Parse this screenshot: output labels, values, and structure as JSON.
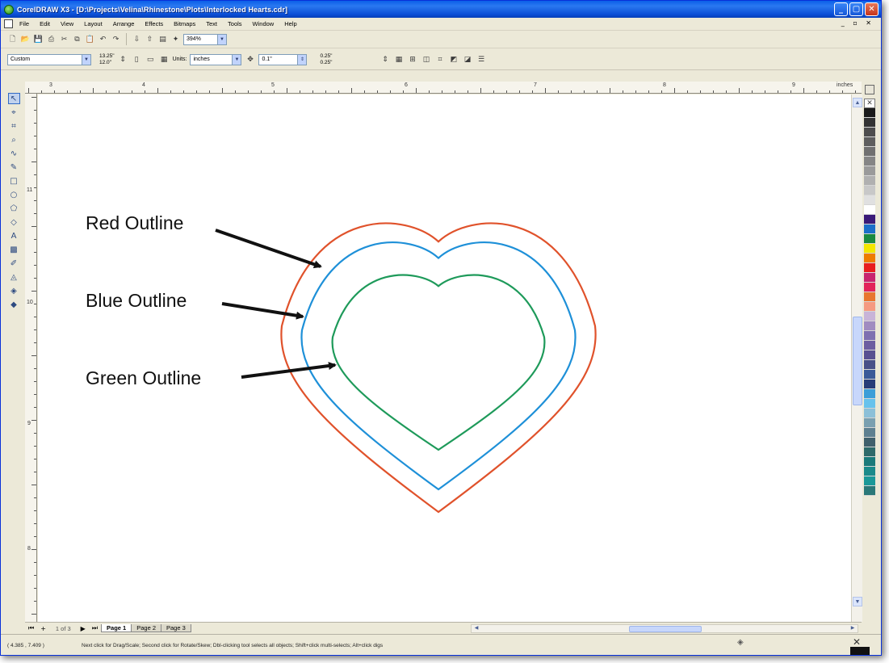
{
  "window": {
    "title": "CorelDRAW X3 - [D:\\Projects\\Velina\\Rhinestone\\Plots\\Interlocked Hearts.cdr]",
    "controls": {
      "minimize": "_",
      "maximize": "▢",
      "close": "✕"
    }
  },
  "menubar": {
    "items": [
      "File",
      "Edit",
      "View",
      "Layout",
      "Arrange",
      "Effects",
      "Bitmaps",
      "Text",
      "Tools",
      "Window",
      "Help"
    ],
    "mdi_controls": "_ ▫ ✕"
  },
  "toolbar": {
    "zoom_value": "394%"
  },
  "property_bar": {
    "paper_type": "Custom",
    "page_width": "13.25\"",
    "page_height": "12.0\"",
    "units_label": "Units:",
    "units_value": "inches",
    "nudge_value": "0.1\"",
    "duplicate_x": "0.25\"",
    "duplicate_y": "0.25\""
  },
  "ruler": {
    "h_labels": [
      "3",
      "4",
      "5",
      "6",
      "7",
      "8",
      "9"
    ],
    "unit": "inches",
    "v_labels": [
      "11",
      "10",
      "9",
      "8"
    ]
  },
  "canvas": {
    "shapes": [
      {
        "name": "Red Outline",
        "color": "#e0522b"
      },
      {
        "name": "Blue Outline",
        "color": "#1e90d8"
      },
      {
        "name": "Green Outline",
        "color": "#1e9a5a"
      }
    ],
    "callouts": {
      "red": "Red Outline",
      "blue": "Blue Outline",
      "green": "Green Outline"
    }
  },
  "palette": {
    "colors": [
      "#1a1a1a",
      "#333333",
      "#4d4d4d",
      "#5e5e5e",
      "#707070",
      "#858585",
      "#9a9a9a",
      "#b0b0b0",
      "#c8c8c8",
      "#e0e0e0",
      "#ffffff",
      "#3a1a78",
      "#1c6fc8",
      "#1a8a40",
      "#f2e600",
      "#ee7c00",
      "#e81e1e",
      "#c8246e",
      "#e2245a",
      "#e8762e",
      "#f59a80",
      "#c8b4d8",
      "#a08cc0",
      "#7e70b0",
      "#6c5ea0",
      "#585090",
      "#485088",
      "#3a5a98",
      "#283c78",
      "#3c9ed8",
      "#68c2ec",
      "#8cc0d8",
      "#7aa0b0",
      "#5e8090",
      "#40606c",
      "#2e6a6a",
      "#1a7a7a",
      "#1a8a8a",
      "#1a9898",
      "#2a7878"
    ]
  },
  "pages": {
    "counter": "1 of 3",
    "tabs": [
      "Page 1",
      "Page 2",
      "Page 3"
    ],
    "active": "Page 1"
  },
  "statusbar": {
    "coords": "( 4.385 , 7.409 )",
    "hint": "Next click for Drag/Scale; Second click for Rotate/Skew; Dbl-clicking tool selects all objects; Shift+click multi-selects; Alt+click digs"
  }
}
